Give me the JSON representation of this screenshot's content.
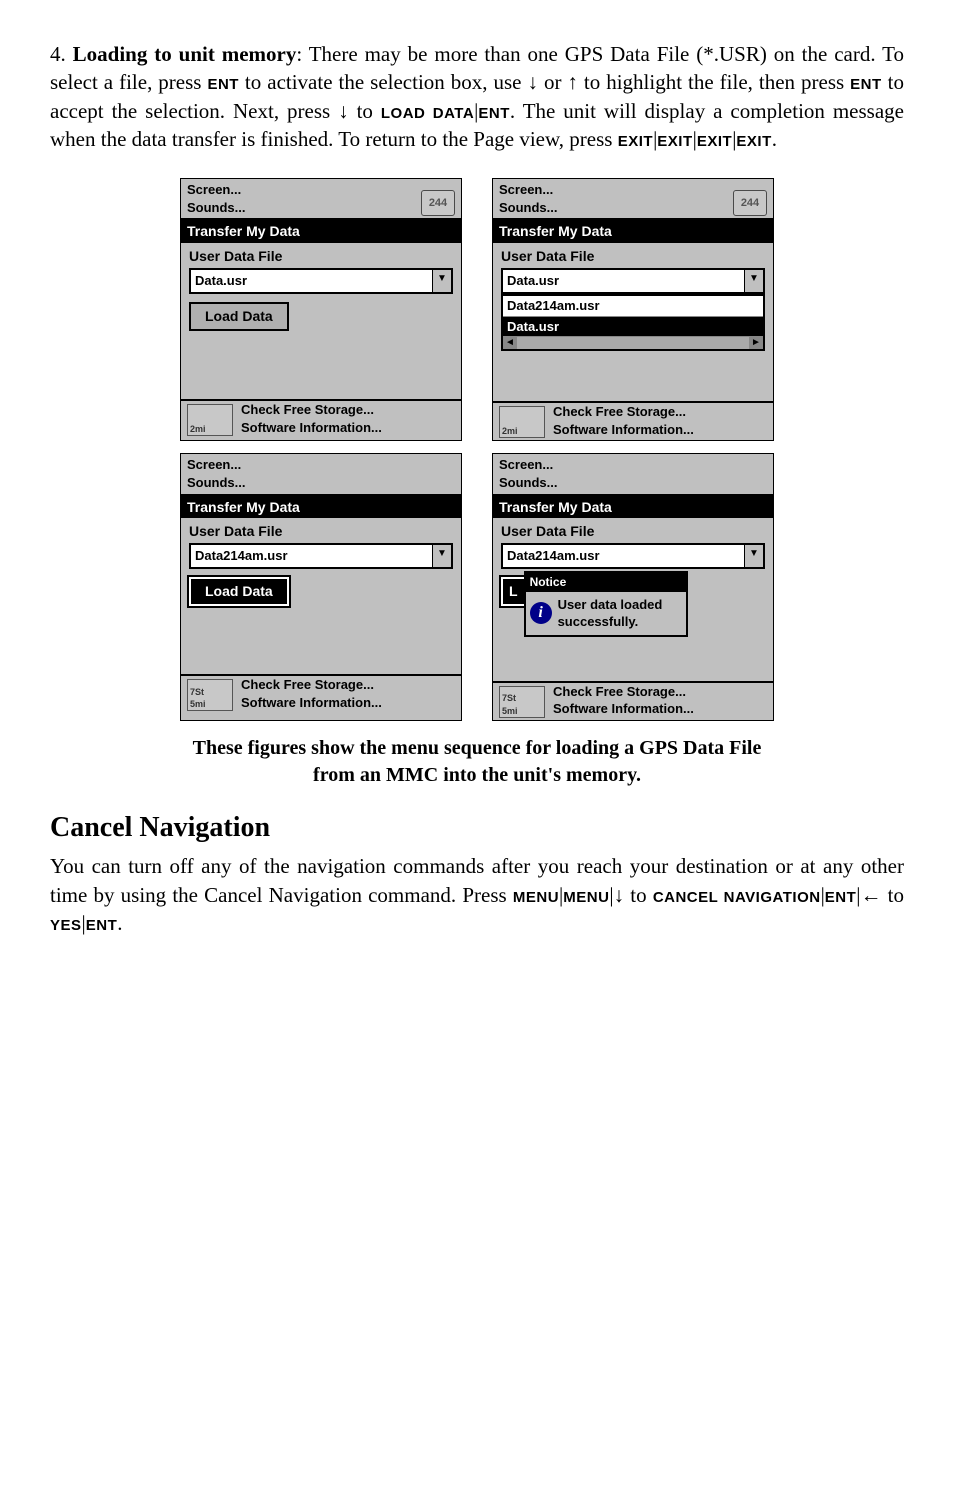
{
  "para1_a": "4. ",
  "para1_b": "Loading to unit memory",
  "para1_c": ": There may be more than one GPS Data File (*.USR) on the card. To select a file, press ",
  "para1_key1": "ENT",
  "para1_d": " to activate the selection box, use ↓ or ↑ to highlight the file, then press ",
  "para1_key2": "ENT",
  "para1_e": " to accept the selection. Next, press ↓ to ",
  "para1_key3": "LOAD DATA",
  "para1_f": "|",
  "para1_key4": "ENT",
  "para1_g": ". The unit will display a completion message when the data transfer is finished. To return to the Page view, press ",
  "para1_key5": "EXIT",
  "para1_h": "|",
  "para1_key6": "EXIT",
  "para1_i": "|",
  "para1_key7": "EXIT",
  "para1_j": "|",
  "para1_key8": "EXIT",
  "para1_k": ".",
  "shots": {
    "s1": {
      "menu1": "Screen...",
      "menu2": "Sounds...",
      "compass": "244",
      "title": "Transfer My Data",
      "label": "User Data File",
      "combo": "Data.usr",
      "btn": "Load Data",
      "foot1": "Check Free Storage...",
      "foot2": "Software Information...",
      "mini": "2mi"
    },
    "s2": {
      "menu1": "Screen...",
      "menu2": "Sounds...",
      "compass": "244",
      "title": "Transfer My Data",
      "label": "User Data File",
      "combo": "Data.usr",
      "opt1": "Data214am.usr",
      "opt2": "Data.usr",
      "foot1": "Check Free Storage...",
      "foot2": "Software Information...",
      "mini": "2mi"
    },
    "s3": {
      "menu1": "Screen...",
      "menu2": "Sounds...",
      "title": "Transfer My Data",
      "label": "User Data File",
      "combo": "Data214am.usr",
      "btn": "Load Data",
      "foot1": "Check Free Storage...",
      "foot2": "Software Information...",
      "mini1": "7St",
      "mini2": "5mi"
    },
    "s4": {
      "menu1": "Screen...",
      "menu2": "Sounds...",
      "title": "Transfer My Data",
      "label": "User Data File",
      "combo": "Data214am.usr",
      "noticeTitle": "Notice",
      "noticeLine1": "User data loaded",
      "noticeLine2": "successfully.",
      "btnpeek": "L",
      "foot1": "Check Free Storage...",
      "foot2": "Software Information...",
      "mini1": "7St",
      "mini2": "5mi"
    }
  },
  "caption_a": "These figures show the menu sequence for loading a GPS Data File",
  "caption_b": "from an MMC into the unit's memory.",
  "h2": "Cancel Navigation",
  "para2_a": "You can turn off any of the navigation commands after you reach your destination or at any other time by using the Cancel Navigation command. Press ",
  "para2_key1": "MENU",
  "para2_b": "|",
  "para2_key2": "MENU",
  "para2_c": "|↓ to ",
  "para2_key3": "CANCEL NAVIGATION",
  "para2_d": "|",
  "para2_key4": "ENT",
  "para2_e": "|← to ",
  "para2_key5": "YES",
  "para2_f": "|",
  "para2_key6": "ENT",
  "para2_g": "."
}
